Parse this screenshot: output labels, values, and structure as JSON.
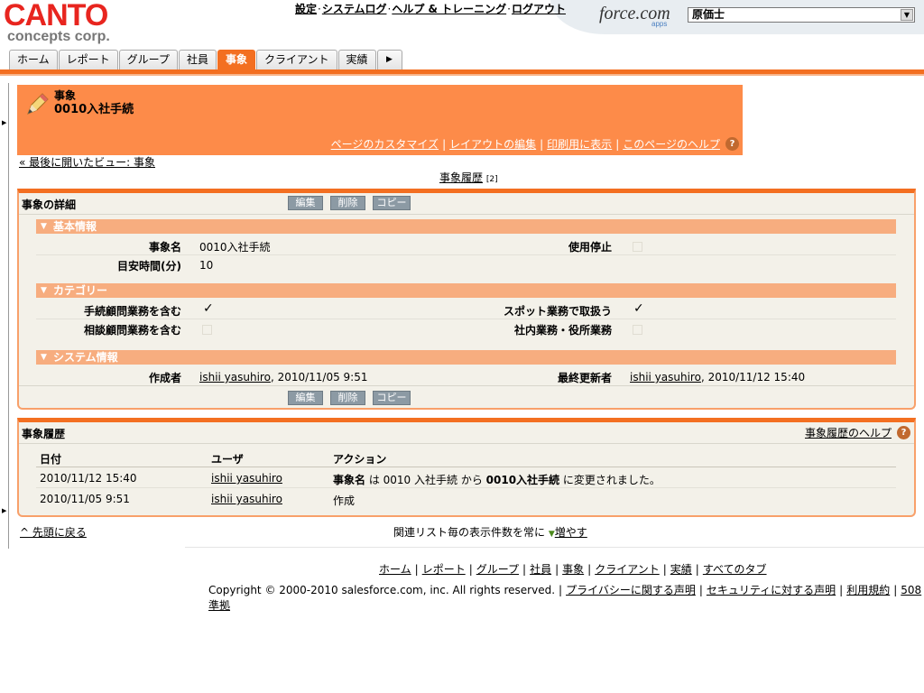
{
  "brand": {
    "logo_top": "CANTO",
    "logo_bottom": "concepts corp."
  },
  "top_links": [
    "設定",
    "システムログ",
    "ヘルプ & トレーニング",
    "ログアウト"
  ],
  "forcecom": {
    "name": "force.com",
    "apps": "apps"
  },
  "app_select": {
    "value": "原価士"
  },
  "tabs": [
    {
      "label": "ホーム"
    },
    {
      "label": "レポート"
    },
    {
      "label": "グループ"
    },
    {
      "label": "社員"
    },
    {
      "label": "事象"
    },
    {
      "label": "クライアント"
    },
    {
      "label": "実績"
    }
  ],
  "colors": {
    "accent": "#f36f21",
    "header_bg": "#fd8b49",
    "section": "#f7ad7f",
    "button": "#8c9aa4"
  },
  "page_header": {
    "type": "事象",
    "title": "0010入社手続",
    "links": [
      "ページのカスタマイズ",
      "レイアウトの編集",
      "印刷用に表示",
      "このページのヘルプ"
    ]
  },
  "back_link": "« 最後に開いたビュー: 事象",
  "history_anchor": {
    "label": "事象履歴",
    "count": "[2]"
  },
  "detail": {
    "title": "事象の詳細",
    "buttons": [
      "編集",
      "削除",
      "コピー"
    ],
    "sections": {
      "basic": {
        "title": "基本情報",
        "name_label": "事象名",
        "name_value": "0010入社手続",
        "disabled_label": "使用停止",
        "time_label": "目安時間(分)",
        "time_value": "10"
      },
      "category": {
        "title": "カテゴリー",
        "a_label": "手続顧問業務を含む",
        "b_label": "スポット業務で取扱う",
        "c_label": "相談顧問業務を含む",
        "d_label": "社内業務・役所業務",
        "check": "✓"
      },
      "system": {
        "title": "システム情報",
        "created_label": "作成者",
        "created_user": "ishii yasuhiro",
        "created_time": ", 2010/11/05 9:51",
        "updated_label": "最終更新者",
        "updated_user": "ishii yasuhiro",
        "updated_time": ", 2010/11/12 15:40"
      }
    }
  },
  "history": {
    "title": "事象履歴",
    "help": "事象履歴のヘルプ",
    "columns": [
      "日付",
      "ユーザ",
      "アクション"
    ],
    "rows": [
      {
        "date": "2010/11/12 15:40",
        "user": "ishii yasuhiro",
        "a_field": "事象名",
        "a_mid": " は 0010 入社手続 から ",
        "a_new": "0010入社手続",
        "a_end": " に変更されました。"
      },
      {
        "date": "2010/11/05 9:51",
        "user": "ishii yasuhiro",
        "action": "作成"
      }
    ]
  },
  "bottom": {
    "top_link": "^ 先頭に戻る",
    "list_prefix": "関連リスト毎の表示件数を常に",
    "list_more": "増やす"
  },
  "footer": {
    "links": [
      "ホーム",
      "レポート",
      "グループ",
      "社員",
      "事象",
      "クライアント",
      "実績",
      "すべてのタブ"
    ],
    "copyright": "Copyright © 2000-2010 salesforce.com, inc. All rights reserved.",
    "legal": [
      "プライバシーに関する声明",
      "セキュリティに対する声明",
      "利用規約",
      "508 準拠"
    ]
  }
}
